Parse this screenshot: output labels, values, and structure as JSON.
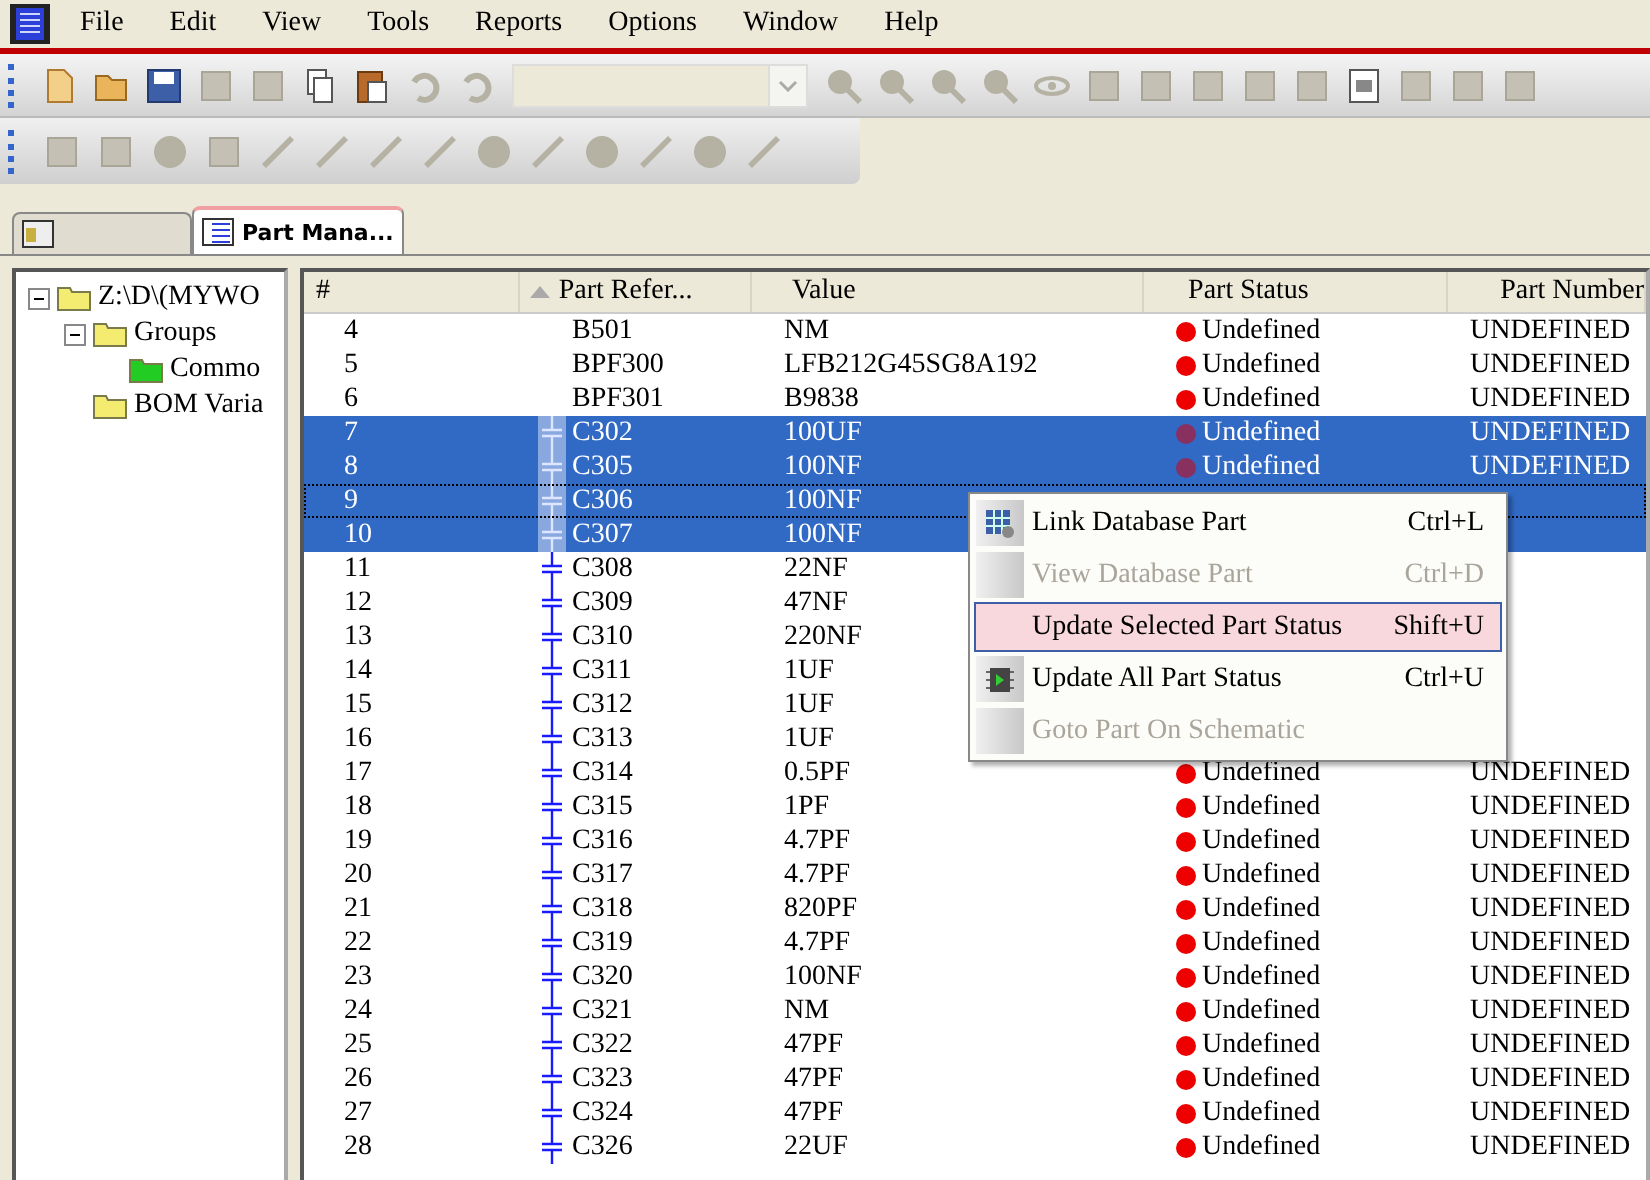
{
  "menu_bar": [
    "File",
    "Edit",
    "View",
    "Tools",
    "Reports",
    "Options",
    "Window",
    "Help"
  ],
  "tabs": [
    {
      "selected": false
    },
    {
      "label": "Part Mana...",
      "selected": true
    }
  ],
  "tree": [
    {
      "label": "Z:\\D\\(MYWO",
      "expanded": true,
      "children": [
        {
          "label": "Groups",
          "expanded": true,
          "children": [
            {
              "label": "Commo",
              "kind": "group"
            }
          ]
        },
        {
          "label": "BOM Varia"
        }
      ]
    }
  ],
  "table": {
    "columns": [
      "#",
      "Part Refer...",
      "Value",
      "Part Status",
      "Part Number"
    ],
    "rows": [
      {
        "n": "4",
        "kind": "part",
        "ref": "B501",
        "value": "NM",
        "status": "Undefined",
        "part_number": "UNDEFINED",
        "selected": false
      },
      {
        "n": "5",
        "kind": "part",
        "ref": "BPF300",
        "value": "LFB212G45SG8A192",
        "status": "Undefined",
        "part_number": "UNDEFINED",
        "selected": false
      },
      {
        "n": "6",
        "kind": "part",
        "ref": "BPF301",
        "value": "B9838",
        "status": "Undefined",
        "part_number": "UNDEFINED",
        "selected": false
      },
      {
        "n": "7",
        "kind": "capacitor",
        "ref": "C302",
        "value": "100UF",
        "status": "Undefined",
        "part_number": "UNDEFINED",
        "selected": true
      },
      {
        "n": "8",
        "kind": "capacitor",
        "ref": "C305",
        "value": "100NF",
        "status": "Undefined",
        "part_number": "UNDEFINED",
        "selected": true
      },
      {
        "n": "9",
        "kind": "capacitor",
        "ref": "C306",
        "value": "100NF",
        "selected": true
      },
      {
        "n": "10",
        "kind": "capacitor",
        "ref": "C307",
        "value": "100NF",
        "selected": true
      },
      {
        "n": "11",
        "kind": "capacitor",
        "ref": "C308",
        "value": "22NF",
        "selected": false
      },
      {
        "n": "12",
        "kind": "capacitor",
        "ref": "C309",
        "value": "47NF",
        "selected": false
      },
      {
        "n": "13",
        "kind": "capacitor",
        "ref": "C310",
        "value": "220NF",
        "selected": false
      },
      {
        "n": "14",
        "kind": "capacitor",
        "ref": "C311",
        "value": "1UF",
        "selected": false
      },
      {
        "n": "15",
        "kind": "capacitor",
        "ref": "C312",
        "value": "1UF",
        "selected": false
      },
      {
        "n": "16",
        "kind": "capacitor",
        "ref": "C313",
        "value": "1UF",
        "selected": false
      },
      {
        "n": "17",
        "kind": "capacitor",
        "ref": "C314",
        "value": "0.5PF",
        "status": "Undefined",
        "part_number": "UNDEFINED",
        "selected": false
      },
      {
        "n": "18",
        "kind": "capacitor",
        "ref": "C315",
        "value": "1PF",
        "status": "Undefined",
        "part_number": "UNDEFINED",
        "selected": false
      },
      {
        "n": "19",
        "kind": "capacitor",
        "ref": "C316",
        "value": "4.7PF",
        "status": "Undefined",
        "part_number": "UNDEFINED",
        "selected": false
      },
      {
        "n": "20",
        "kind": "capacitor",
        "ref": "C317",
        "value": "4.7PF",
        "status": "Undefined",
        "part_number": "UNDEFINED",
        "selected": false
      },
      {
        "n": "21",
        "kind": "capacitor",
        "ref": "C318",
        "value": "820PF",
        "status": "Undefined",
        "part_number": "UNDEFINED",
        "selected": false
      },
      {
        "n": "22",
        "kind": "capacitor",
        "ref": "C319",
        "value": "4.7PF",
        "status": "Undefined",
        "part_number": "UNDEFINED",
        "selected": false
      },
      {
        "n": "23",
        "kind": "capacitor",
        "ref": "C320",
        "value": "100NF",
        "status": "Undefined",
        "part_number": "UNDEFINED",
        "selected": false
      },
      {
        "n": "24",
        "kind": "capacitor",
        "ref": "C321",
        "value": "NM",
        "status": "Undefined",
        "part_number": "UNDEFINED",
        "selected": false
      },
      {
        "n": "25",
        "kind": "capacitor",
        "ref": "C322",
        "value": "47PF",
        "status": "Undefined",
        "part_number": "UNDEFINED",
        "selected": false
      },
      {
        "n": "26",
        "kind": "capacitor",
        "ref": "C323",
        "value": "47PF",
        "status": "Undefined",
        "part_number": "UNDEFINED",
        "selected": false
      },
      {
        "n": "27",
        "kind": "capacitor",
        "ref": "C324",
        "value": "47PF",
        "status": "Undefined",
        "part_number": "UNDEFINED",
        "selected": false
      },
      {
        "n": "28",
        "kind": "capacitor",
        "ref": "C326",
        "value": "22UF",
        "status": "Undefined",
        "part_number": "UNDEFINED",
        "selected": false
      }
    ]
  },
  "context_menu": [
    {
      "label": "Link Database Part",
      "shortcut": "Ctrl+L",
      "disabled": false,
      "selected": false,
      "kind": "link"
    },
    {
      "label": "View Database Part",
      "shortcut": "Ctrl+D",
      "disabled": true,
      "selected": false,
      "kind": "plain"
    },
    {
      "label": "Update Selected Part Status",
      "shortcut": "Shift+U",
      "disabled": false,
      "selected": true,
      "kind": "plain"
    },
    {
      "label": "Update All Part Status",
      "shortcut": "Ctrl+U",
      "disabled": false,
      "selected": false,
      "kind": "chip"
    },
    {
      "label": "Goto Part On Schematic",
      "disabled": true,
      "selected": false,
      "kind": "plain"
    }
  ]
}
